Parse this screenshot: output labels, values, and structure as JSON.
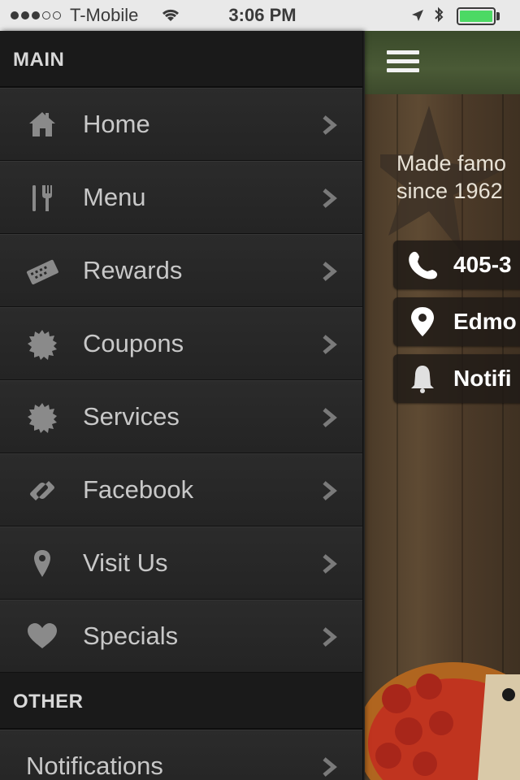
{
  "status_bar": {
    "carrier": "T-Mobile",
    "time": "3:06 PM",
    "battery_level": 1.0,
    "battery_color": "#4cd964",
    "signal_bars_filled": 3,
    "signal_bars_total": 5
  },
  "drawer": {
    "sections": [
      {
        "title": "MAIN",
        "items": [
          {
            "label": "Home",
            "icon": "home-icon"
          },
          {
            "label": "Menu",
            "icon": "fork-knife-icon"
          },
          {
            "label": "Rewards",
            "icon": "card-icon"
          },
          {
            "label": "Coupons",
            "icon": "seal-icon"
          },
          {
            "label": "Services",
            "icon": "seal-icon"
          },
          {
            "label": "Facebook",
            "icon": "link-icon"
          },
          {
            "label": "Visit Us",
            "icon": "location-pin-icon"
          },
          {
            "label": "Specials",
            "icon": "heart-icon"
          }
        ]
      },
      {
        "title": "OTHER",
        "items": [
          {
            "label": "Notifications",
            "icon": ""
          }
        ]
      }
    ]
  },
  "content": {
    "tagline": "Made famo since 1962",
    "tagline_lines": [
      "Made famo",
      "since 1962"
    ],
    "actions": [
      {
        "label": "405-3",
        "icon": "phone-icon"
      },
      {
        "label": "Edmo",
        "icon": "location-pin-icon"
      },
      {
        "label": "Notifi",
        "icon": "bell-icon"
      }
    ]
  },
  "colors": {
    "drawer_bg": "#1f1f1f",
    "menu_text": "#c8c8c8",
    "section_text": "#d8d8d8"
  }
}
